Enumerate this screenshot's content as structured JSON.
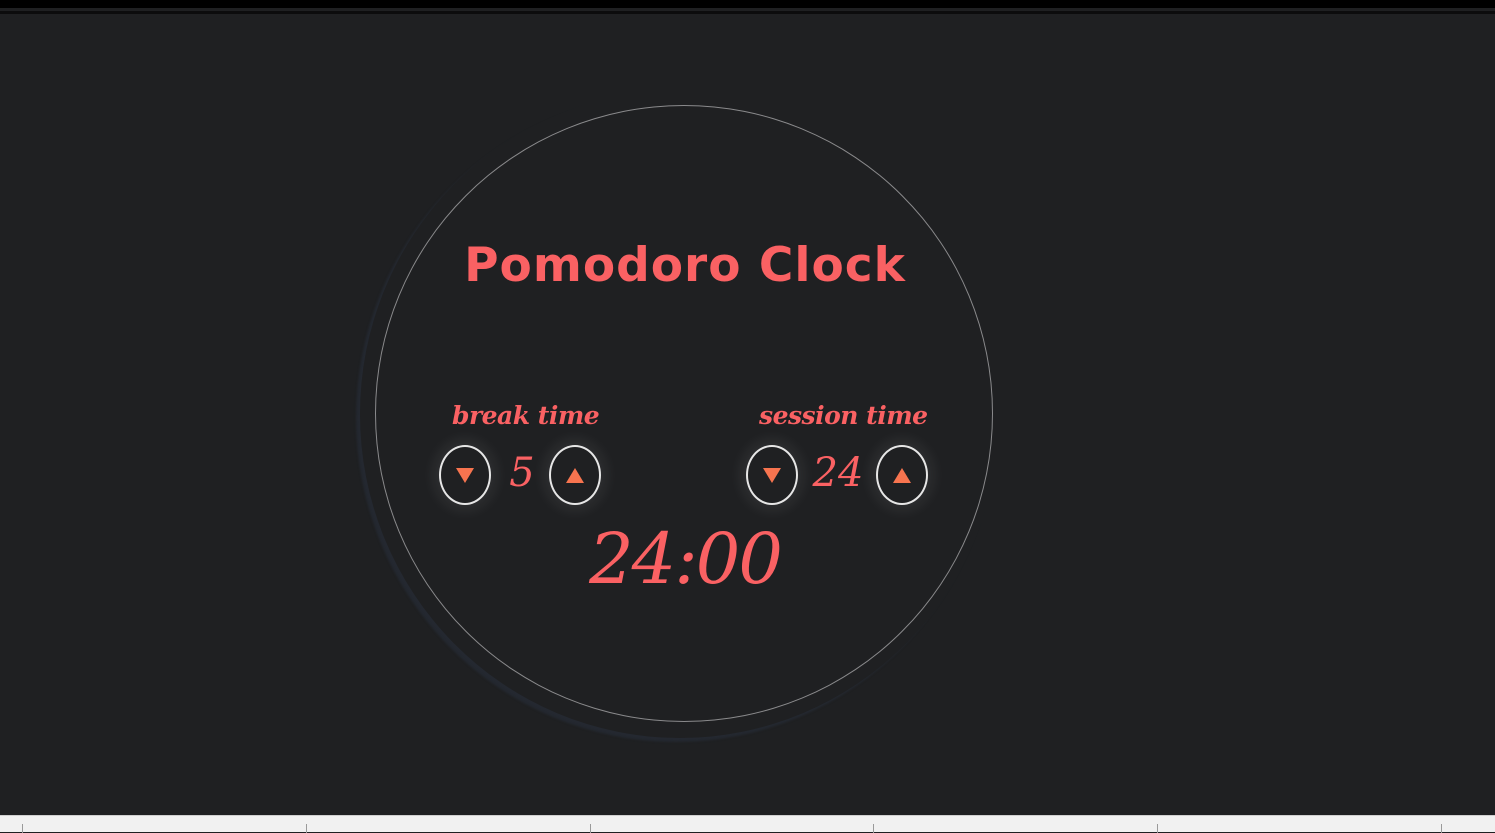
{
  "app": {
    "title": "Pomodoro Clock"
  },
  "break": {
    "label": "break time",
    "value": "5",
    "decrease_icon": "triangle-down-icon",
    "increase_icon": "triangle-up-icon"
  },
  "session": {
    "label": "session time",
    "value": "24",
    "decrease_icon": "triangle-down-icon",
    "increase_icon": "triangle-up-icon"
  },
  "timer": {
    "display": "24:00"
  },
  "colors": {
    "background": "#1f2022",
    "accent": "#fa6163",
    "arrow": "#f7744f",
    "ring": "#8a8a8c"
  }
}
